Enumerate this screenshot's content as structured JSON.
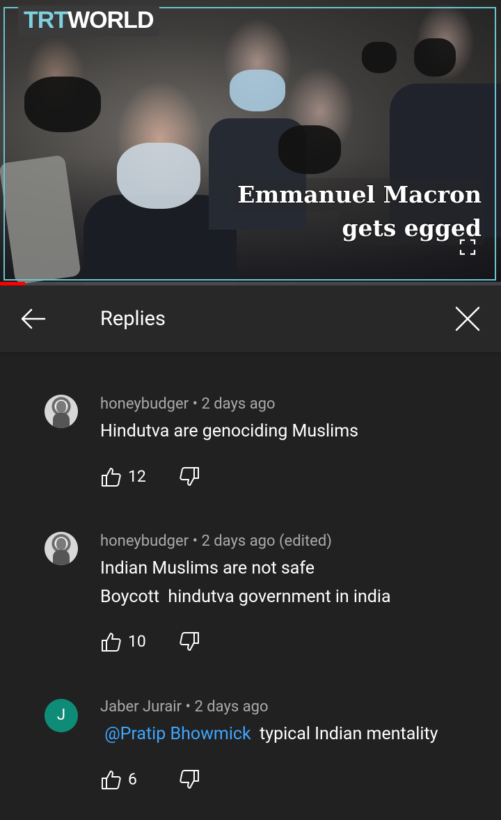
{
  "video": {
    "logo_trt": "TRT",
    "logo_world": "WORLD",
    "caption_line1": "Emmanuel Macron",
    "caption_line2": "gets egged",
    "progress": 0.05
  },
  "header": {
    "title": "Replies"
  },
  "comments": [
    {
      "author": "honeybudger",
      "meta": "honeybudger • 2 days ago",
      "lines": [
        "Hindutva are genociding Muslims"
      ],
      "likes": "12",
      "avatar": "photo"
    },
    {
      "author": "honeybudger",
      "meta": "honeybudger • 2 days ago (edited)",
      "lines": [
        "Indian Muslims are not safe",
        "Boycott  hindutva government in india"
      ],
      "likes": "10",
      "avatar": "photo"
    },
    {
      "author": "Jaber Jurair",
      "meta": "Jaber Jurair • 2 days ago",
      "mention": " @Pratip Bhowmick ",
      "lines": [
        " typical Indian mentality"
      ],
      "likes": "6",
      "avatar": "letter",
      "avatar_letter": "J",
      "avatar_color": "#0f8c78"
    }
  ],
  "icons": {
    "back": "arrow-left-icon",
    "close": "close-icon",
    "like": "thumbs-up-icon",
    "dislike": "thumbs-down-icon",
    "fullscreen": "fullscreen-icon"
  },
  "colors": {
    "background": "#212121",
    "header": "#282828",
    "meta_text": "#aaaaaa",
    "mention": "#3ea6ff",
    "progress": "#ff0000"
  }
}
